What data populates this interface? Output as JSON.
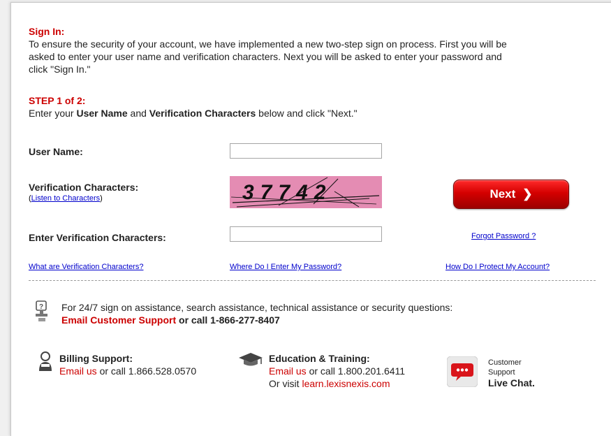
{
  "signin": {
    "title": "Sign In:",
    "intro_line1": "To ensure the security of your account, we have implemented a new two-step sign on process.  First you will be",
    "intro_line2": "asked to enter your user name and verification characters.  Next you will be asked to enter your password and",
    "intro_line3": "click \"Sign In.\""
  },
  "step": {
    "title": "STEP 1 of 2:",
    "pre": "Enter your ",
    "bold1": "User Name",
    "mid": " and ",
    "bold2": "Verification Characters",
    "post": " below and click \"Next.\""
  },
  "form": {
    "username_label": "User Name:",
    "username_value": "",
    "verification_label": "Verification Characters:",
    "listen_open": "(",
    "listen_link": "Listen to Characters",
    "listen_close": ")",
    "captcha_text": "37742",
    "enter_verification_label": "Enter Verification Characters:",
    "enter_verification_value": "",
    "next_label": "Next",
    "forgot_password": "Forgot Password ?"
  },
  "links": {
    "what_are": "What are Verification Characters?",
    "where_password": "Where Do I Enter My Password?",
    "protect": "How Do I Protect My Account?"
  },
  "assist": {
    "line1": "For 24/7 sign on assistance, search assistance, technical assistance or security questions:",
    "email_link": "Email Customer Support",
    "call_text": " or call 1-866-277-8407"
  },
  "billing": {
    "title": "Billing Support:",
    "email_link": "Email us",
    "call_text": " or call 1.866.528.0570"
  },
  "education": {
    "title": "Education & Training:",
    "email_link": "Email us",
    "call_text": " or call 1.800.201.6411",
    "visit_text": "Or visit ",
    "visit_link": "learn.lexisnexis.com"
  },
  "livechat": {
    "line1": "Customer",
    "line2": "Support",
    "line3": "Live Chat."
  },
  "colors": {
    "accent_red": "#cc0000",
    "link_blue": "#0000cc",
    "captcha_bg": "#e48cb3"
  },
  "icons": {
    "help": "help-desk-icon",
    "billing": "billing-person-icon",
    "education": "graduation-cap-icon",
    "chat": "chat-bubble-icon"
  }
}
